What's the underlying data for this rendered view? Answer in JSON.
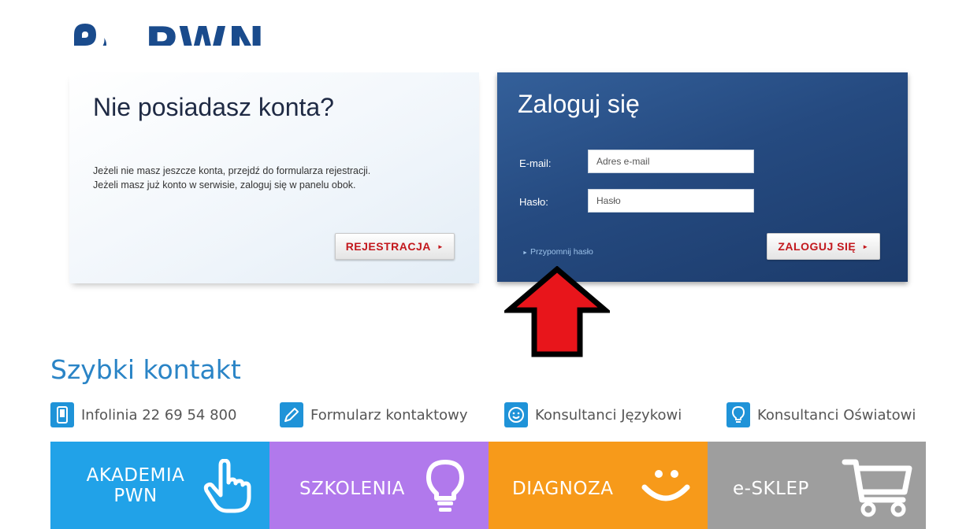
{
  "logo": {
    "text": "PWN"
  },
  "register": {
    "title": "Nie posiadasz konta?",
    "line1": "Jeżeli nie masz jeszcze konta, przejdź do formularza rejestracji.",
    "line2": "Jeżeli masz już konto w serwisie, zaloguj się w panelu obok.",
    "button": "REJESTRACJA"
  },
  "login": {
    "title": "Zaloguj się",
    "email_label": "E-mail:",
    "email_placeholder": "Adres e-mail",
    "password_label": "Hasło:",
    "password_placeholder": "Hasło",
    "forgot": "Przypomnij hasło",
    "button": "ZALOGUJ SIĘ"
  },
  "quick_contact": {
    "title": "Szybki kontakt",
    "items": [
      {
        "label": "Infolinia 22 69 54 800",
        "icon": "phone-icon"
      },
      {
        "label": "Formularz kontaktowy",
        "icon": "pencil-icon"
      },
      {
        "label": "Konsultanci Językowi",
        "icon": "smiley-icon"
      },
      {
        "label": "Konsultanci Oświatowi",
        "icon": "lightbulb-icon"
      }
    ]
  },
  "tiles": [
    {
      "label_line1": "AKADEMIA",
      "label_line2": "PWN",
      "icon": "hand-pointer-icon",
      "color": "#21a2e8"
    },
    {
      "label": "SZKOLENIA",
      "icon": "lightbulb-icon",
      "color": "#b179ec"
    },
    {
      "label": "DIAGNOZA",
      "icon": "smile-icon",
      "color": "#f79a1a"
    },
    {
      "label": "e-SKLEP",
      "icon": "cart-icon",
      "color": "#9e9e9e"
    }
  ],
  "colors": {
    "brand": "#1a4b8c",
    "accent_red": "#c3171c",
    "link_blue": "#2a84c6",
    "arrow": "#e8151b"
  }
}
